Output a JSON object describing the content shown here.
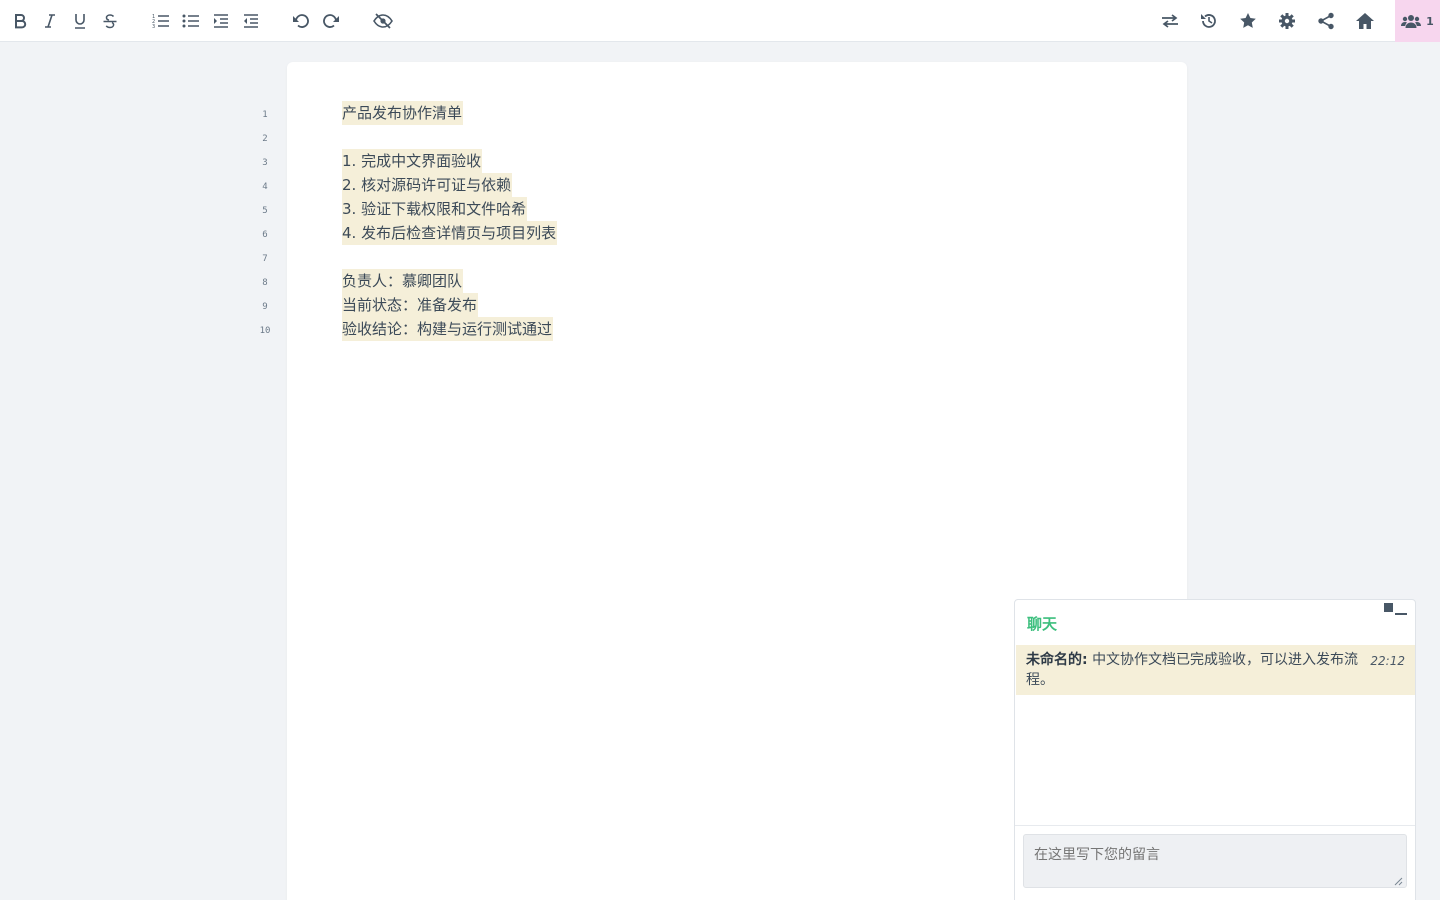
{
  "toolbar": {
    "left_buttons": [
      "bold-icon",
      "italic-icon",
      "underline-icon",
      "strikethrough-icon",
      "numbered-list-icon",
      "bullet-list-icon",
      "indent-icon",
      "outdent-icon",
      "undo-icon",
      "redo-icon",
      "hide-author-colors-icon"
    ],
    "right_buttons": [
      "import-export-icon",
      "history-icon",
      "star-icon",
      "settings-icon",
      "share-icon",
      "home-icon"
    ],
    "users_count": "1"
  },
  "editor": {
    "line_numbers": [
      "1",
      "2",
      "3",
      "4",
      "5",
      "6",
      "7",
      "8",
      "9",
      "10"
    ],
    "lines": [
      "产品发布协作清单",
      "",
      "1. 完成中文界面验收",
      "2. 核对源码许可证与依赖",
      "3. 验证下载权限和文件哈希",
      "4. 发布后检查详情页与项目列表",
      "",
      "负责人：慕卿团队",
      "当前状态：准备发布",
      "验收结论：构建与运行测试通过"
    ]
  },
  "chat": {
    "title": "聊天",
    "messages": [
      {
        "author": "未命名的:",
        "text": "中文协作文档已完成验收，可以进入发布流程。",
        "time": "22:12"
      }
    ],
    "input_placeholder": "在这里写下您的留言"
  },
  "colors": {
    "author_highlight": "#f5efd9",
    "chat_title": "#3dbf7e",
    "users_button_bg": "#f7d6ee",
    "background": "#f1f3f6"
  }
}
